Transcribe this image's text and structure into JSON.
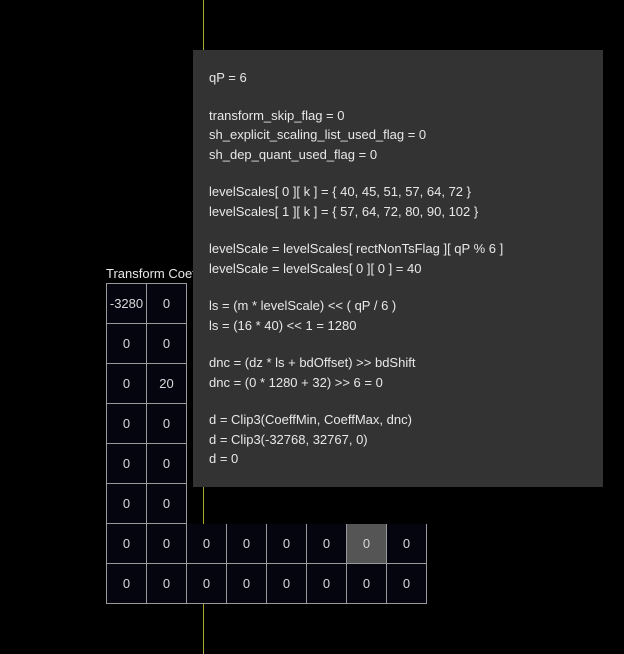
{
  "vertical_line_color": "#a8a830",
  "table": {
    "title": "Transform Coeffs",
    "highlighted": {
      "row": 6,
      "col": 6
    },
    "rows": [
      [
        "-3280",
        "0",
        "",
        "",
        "",
        "",
        "",
        ""
      ],
      [
        "0",
        "0",
        "",
        "",
        "",
        "",
        "",
        ""
      ],
      [
        "0",
        "20",
        "",
        "",
        "",
        "",
        "",
        ""
      ],
      [
        "0",
        "0",
        "",
        "",
        "",
        "",
        "",
        ""
      ],
      [
        "0",
        "0",
        "",
        "",
        "",
        "",
        "",
        ""
      ],
      [
        "0",
        "0",
        "",
        "",
        "",
        "",
        "",
        ""
      ],
      [
        "0",
        "0",
        "0",
        "0",
        "0",
        "0",
        "0",
        "0"
      ],
      [
        "0",
        "0",
        "0",
        "0",
        "0",
        "0",
        "0",
        "0"
      ]
    ]
  },
  "tooltip": {
    "lines": [
      "qP = 6",
      "",
      "transform_skip_flag = 0",
      "sh_explicit_scaling_list_used_flag = 0",
      "sh_dep_quant_used_flag = 0",
      "",
      "levelScales[ 0 ][ k ] = { 40, 45, 51, 57, 64, 72  }",
      "levelScales[ 1 ][ k ] = { 57, 64, 72, 80, 90, 102 }",
      "",
      "levelScale = levelScales[ rectNonTsFlag ][ qP % 6 ]",
      "levelScale = levelScales[ 0 ][ 0 ] = 40",
      "",
      "ls = (m * levelScale) << ( qP / 6 )",
      "ls = (16 * 40) << 1 = 1280",
      "",
      "dnc = (dz * ls + bdOffset) >> bdShift",
      "dnc = (0 * 1280 + 32) >> 6 = 0",
      "",
      "d = Clip3(CoeffMin, CoeffMax, dnc)",
      "d = Clip3(-32768, 32767, 0)",
      "d = 0"
    ]
  }
}
